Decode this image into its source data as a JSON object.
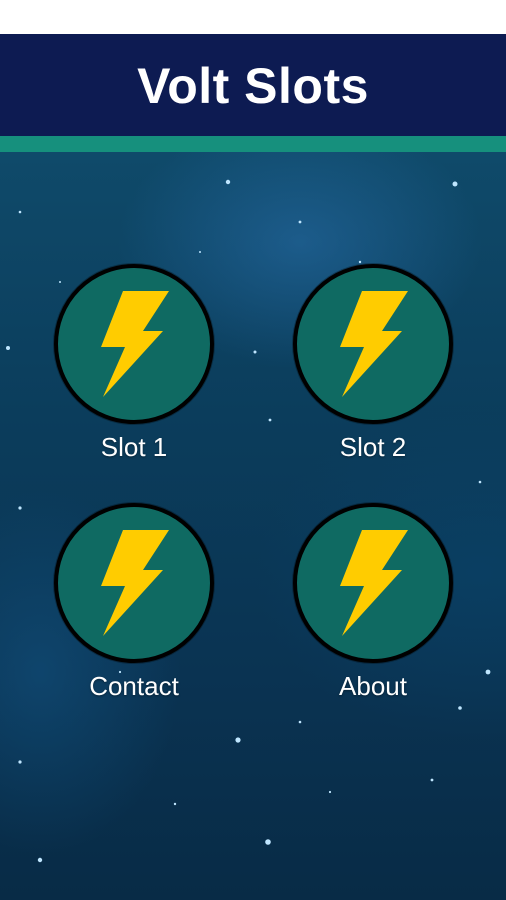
{
  "app": {
    "title": "Volt Slots"
  },
  "menu": {
    "items": [
      {
        "label": "Slot 1",
        "icon": "lightning-bolt-icon"
      },
      {
        "label": "Slot 2",
        "icon": "lightning-bolt-icon"
      },
      {
        "label": "Contact",
        "icon": "lightning-bolt-icon"
      },
      {
        "label": "About",
        "icon": "lightning-bolt-icon"
      }
    ]
  },
  "colors": {
    "header_background": "#0d1b52",
    "header_stripe": "#16907d",
    "circle_fill": "#0f6a62",
    "bolt": "#ffcc00",
    "background": "#0b3d5c"
  }
}
